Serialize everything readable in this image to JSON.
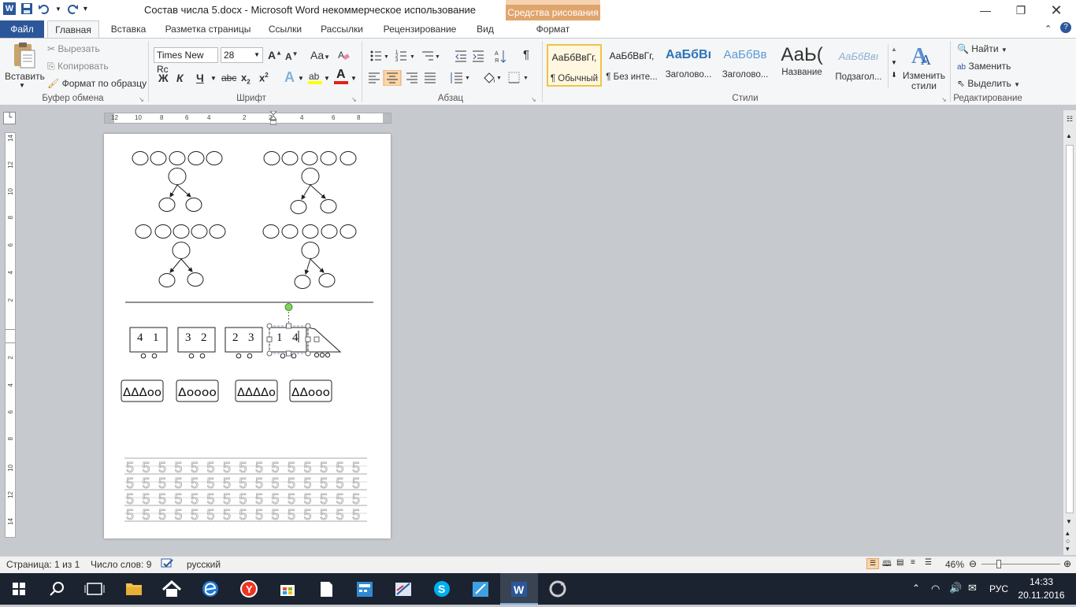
{
  "window": {
    "title": "Состав числа 5.docx  -  Microsoft Word некоммерческое использование",
    "contextual_tab_group": "Средства рисования"
  },
  "tabs": [
    "Файл",
    "Главная",
    "Вставка",
    "Разметка страницы",
    "Ссылки",
    "Рассылки",
    "Рецензирование",
    "Вид",
    "Формат"
  ],
  "ribbon": {
    "clipboard": {
      "paste": "Вставить",
      "cut": "Вырезать",
      "copy": "Копировать",
      "format_painter": "Формат по образцу",
      "group_label": "Буфер обмена"
    },
    "font": {
      "font_name": "Times New Rc",
      "font_size": "28",
      "grow": "A",
      "shrink": "A",
      "change_case": "Aa",
      "bold": "Ж",
      "italic": "К",
      "underline": "Ч",
      "strike": "abc",
      "subscript": "x",
      "superscript": "x",
      "effects": "A",
      "font_color": "A",
      "group_label": "Шрифт"
    },
    "paragraph": {
      "group_label": "Абзац",
      "pilcrow": "¶"
    },
    "styles": {
      "items": [
        {
          "preview": "АаБбВвГг,",
          "label": "¶ Обычный"
        },
        {
          "preview": "АаБбВвГг,",
          "label": "¶ Без инте..."
        },
        {
          "preview": "АаБбВı",
          "label": "Заголово..."
        },
        {
          "preview": "АаБбВв",
          "label": "Заголово..."
        },
        {
          "preview": "АаЬ(",
          "label": "Название"
        },
        {
          "preview": "АаБбВвı",
          "label": "Подзагол..."
        }
      ],
      "change_styles": "Изменить стили",
      "group_label": "Стили"
    },
    "editing": {
      "find": "Найти",
      "replace": "Заменить",
      "select": "Выделить",
      "group_label": "Редактирование"
    }
  },
  "ruler": {
    "h_labels": [
      "12",
      "10",
      "8",
      "6",
      "4",
      "2",
      "2",
      "4",
      "6",
      "8"
    ],
    "v_labels": [
      "14",
      "12",
      "10",
      "8",
      "6",
      "4",
      "2",
      "2",
      "4",
      "6",
      "8",
      "10",
      "12",
      "14"
    ]
  },
  "document": {
    "wagons": [
      {
        "a": "4",
        "b": "1"
      },
      {
        "a": "3",
        "b": "2"
      },
      {
        "a": "2",
        "b": "3"
      },
      {
        "a": "1",
        "b": "4"
      }
    ],
    "shape_cards": [
      "ΔΔΔoo",
      "Δoooo",
      "ΔΔΔΔo",
      "ΔΔooo"
    ],
    "practice_digit": "5"
  },
  "status": {
    "page": "Страница: 1 из 1",
    "words": "Число слов: 9",
    "language": "русский",
    "zoom": "46%"
  },
  "taskbar": {
    "language": "РУС",
    "time": "14:33",
    "date": "20.11.2016"
  }
}
